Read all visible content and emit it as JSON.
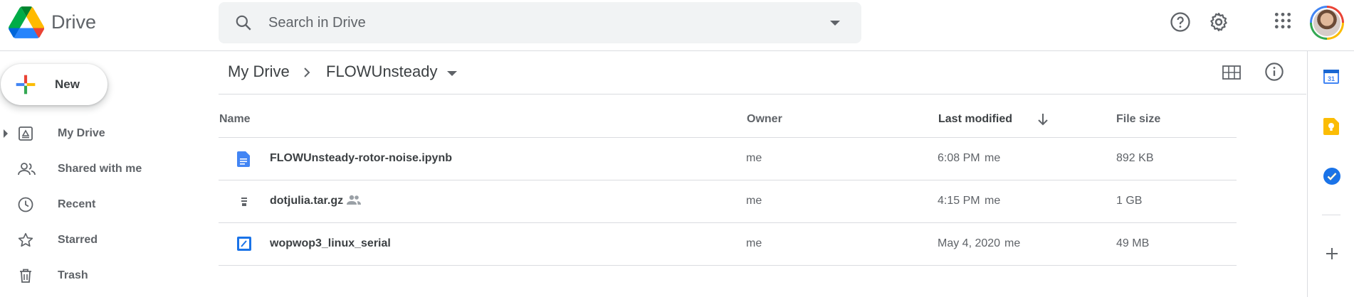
{
  "app": {
    "brand": "Drive"
  },
  "search": {
    "placeholder": "Search in Drive"
  },
  "sidebar": {
    "new_label": "New",
    "items": [
      {
        "label": "My Drive",
        "icon": "my-drive-icon"
      },
      {
        "label": "Shared with me",
        "icon": "shared-icon"
      },
      {
        "label": "Recent",
        "icon": "clock-icon"
      },
      {
        "label": "Starred",
        "icon": "star-icon"
      },
      {
        "label": "Trash",
        "icon": "trash-icon"
      }
    ]
  },
  "breadcrumb": {
    "root": "My Drive",
    "current": "FLOWUnsteady"
  },
  "table": {
    "headers": {
      "name": "Name",
      "owner": "Owner",
      "modified": "Last modified",
      "size": "File size"
    },
    "rows": [
      {
        "name": "FLOWUnsteady-rotor-noise.ipynb",
        "owner": "me",
        "modified": "6:08 PM",
        "modified_by": "me",
        "size": "892 KB",
        "icon": "doc-icon",
        "shared": false
      },
      {
        "name": "dotjulia.tar.gz",
        "owner": "me",
        "modified": "4:15 PM",
        "modified_by": "me",
        "size": "1 GB",
        "icon": "archive-icon",
        "shared": true
      },
      {
        "name": "wopwop3_linux_serial",
        "owner": "me",
        "modified": "May 4, 2020",
        "modified_by": "me",
        "size": "49 MB",
        "icon": "binary-icon",
        "shared": false
      }
    ]
  },
  "side_panel": {
    "calendar_day": "31"
  },
  "colors": {
    "blue": "#4285f4",
    "yellow": "#fbbc04",
    "green": "#34a853",
    "red": "#ea4335",
    "text": "#3c4043"
  }
}
